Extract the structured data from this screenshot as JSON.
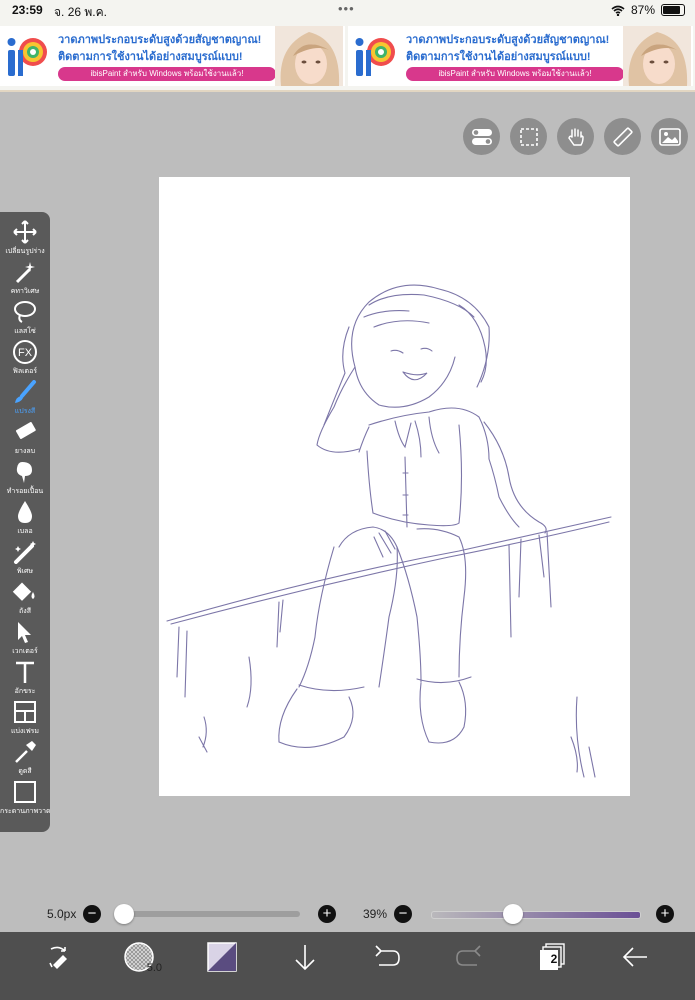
{
  "status_bar": {
    "time": "23:59",
    "date": "จ. 26 พ.ค.",
    "dots": "•••",
    "battery": "87%"
  },
  "ads": [
    {
      "line1": "วาดภาพประกอบระดับสูงด้วยสัญชาตญาณ!",
      "line2": "ติดตามการใช้งานได้อย่างสมบูรณ์แบบ!",
      "line3": "ibisPaint สำหรับ Windows พร้อมใช้งานแล้ว!"
    },
    {
      "line1": "วาดภาพประกอบระดับสูงด้วยสัญชาตญาณ!",
      "line2": "ติดตามการใช้งานได้อย่างสมบูรณ์แบบ!",
      "line3": "ibisPaint สำหรับ Windows พร้อมใช้งานแล้ว!"
    }
  ],
  "top_tools": [
    "toggle-settings-icon",
    "selection-icon",
    "hand-icon",
    "ruler-icon",
    "image-icon"
  ],
  "tools": [
    {
      "icon": "move-icon",
      "label": "เปลี่ยนรูปร่าง"
    },
    {
      "icon": "magic-wand-icon",
      "label": "คทาวิเศษ"
    },
    {
      "icon": "lasso-icon",
      "label": "แลสโซ่"
    },
    {
      "icon": "fx-icon",
      "label": "ฟิลเตอร์"
    },
    {
      "icon": "brush-icon",
      "label": "แปรงสี"
    },
    {
      "icon": "eraser-icon",
      "label": "ยางลบ"
    },
    {
      "icon": "smudge-icon",
      "label": "ทำรอยเปื้อน"
    },
    {
      "icon": "blur-icon",
      "label": "เบลอ"
    },
    {
      "icon": "special-icon",
      "label": "พิเศษ"
    },
    {
      "icon": "fill-icon",
      "label": "ถังสี"
    },
    {
      "icon": "vector-icon",
      "label": "เวกเตอร์"
    },
    {
      "icon": "text-icon",
      "label": "อักขระ"
    },
    {
      "icon": "frame-divider-icon",
      "label": "แบ่งเฟรม"
    },
    {
      "icon": "eyedropper-icon",
      "label": "ดูดสี"
    },
    {
      "icon": "canvas-icon",
      "label": "กระดานภาพวาด"
    }
  ],
  "active_tool": "แปรงสี",
  "brush_size": {
    "label": "5.0px",
    "value_fraction": 0.02
  },
  "opacity": {
    "label": "39%",
    "value": 39
  },
  "bottom_bar": {
    "brush_preview_label": "5.0",
    "layer_count": "2"
  },
  "colors": {
    "accent": "#4aa3ff",
    "stroke": "#7c76a8",
    "canvas_bg": "#bdbdbd"
  }
}
